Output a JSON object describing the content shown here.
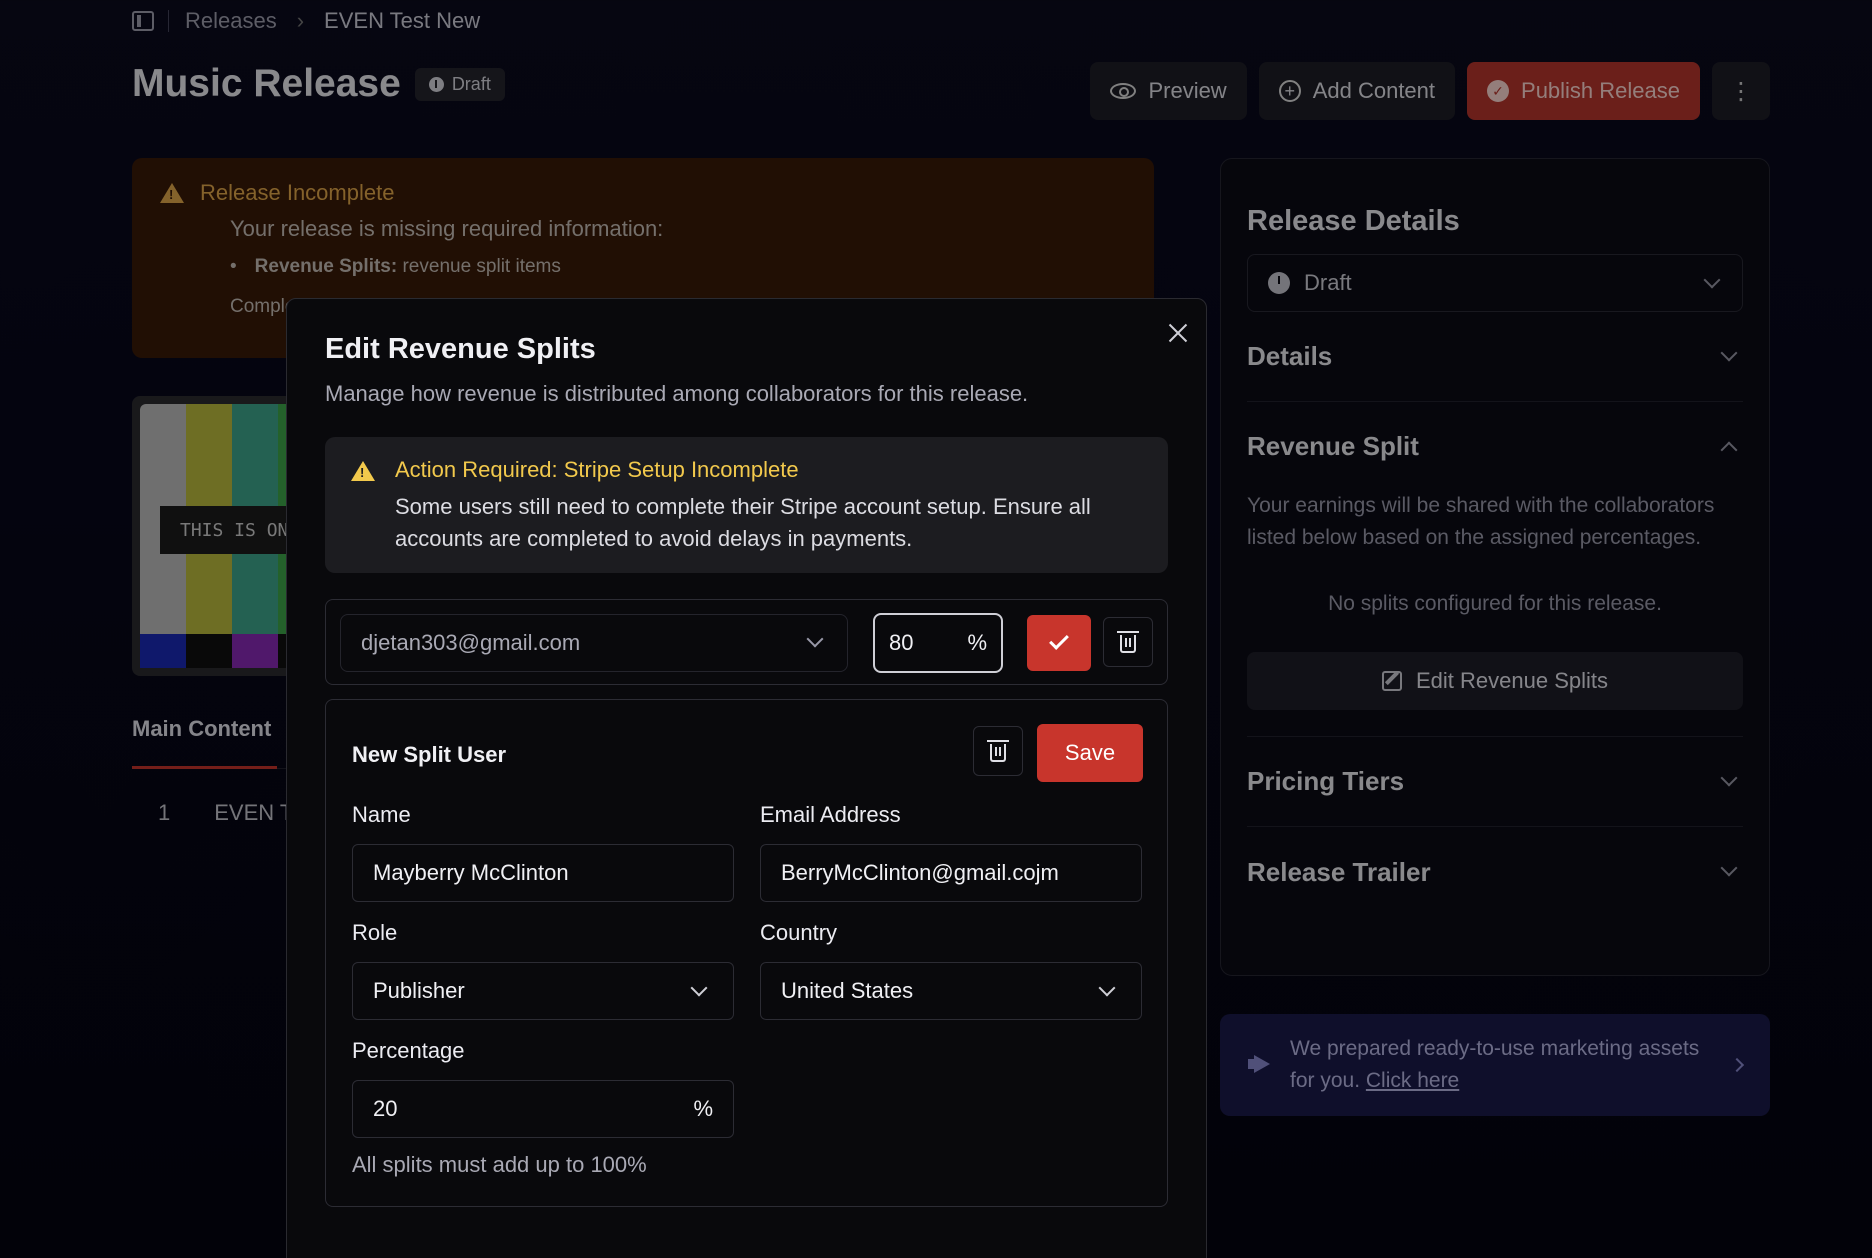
{
  "breadcrumb": {
    "section": "Releases",
    "current": "EVEN Test New"
  },
  "header": {
    "title": "Music Release",
    "status_badge": "Draft"
  },
  "actions": {
    "preview": "Preview",
    "add_content": "Add Content",
    "publish": "Publish Release",
    "more": "⋮"
  },
  "alert": {
    "title": "Release Incomplete",
    "subtitle": "Your release is missing required information:",
    "item_key": "Revenue Splits:",
    "item_value": " revenue split items",
    "footer": "Complete"
  },
  "cover": {
    "text": "THIS IS ONL"
  },
  "main": {
    "tab": "Main Content",
    "track_number": "1",
    "track_title": "EVEN Te"
  },
  "sidebar": {
    "title": "Release Details",
    "status_select": "Draft",
    "details": "Details",
    "revenue_split": {
      "title": "Revenue Split",
      "description": "Your earnings will be shared with the collaborators listed below based on the assigned percentages.",
      "empty": "No splits configured for this release.",
      "edit_button": "Edit Revenue Splits"
    },
    "pricing_tiers": "Pricing Tiers",
    "release_trailer": "Release Trailer"
  },
  "marketing": {
    "text": "We prepared ready-to-use marketing assets for you. ",
    "link": "Click here"
  },
  "modal": {
    "title": "Edit Revenue Splits",
    "subtitle": "Manage how revenue is distributed among collaborators for this release.",
    "warning": {
      "title": "Action Required: Stripe Setup Incomplete",
      "text": "Some users still need to complete their Stripe account setup. Ensure all accounts are completed to avoid delays in payments."
    },
    "split": {
      "email": "djetan303@gmail.com",
      "percentage": "80",
      "percent_sign": "%"
    },
    "new_split": {
      "title": "New Split User",
      "save": "Save",
      "name_label": "Name",
      "name_value": "Mayberry McClinton",
      "email_label": "Email Address",
      "email_value": "BerryMcClinton@gmail.cojm",
      "role_label": "Role",
      "role_value": "Publisher",
      "country_label": "Country",
      "country_value": "United States",
      "percentage_label": "Percentage",
      "percentage_value": "20",
      "percent_sign": "%",
      "hint": "All splits must add up to 100%"
    }
  },
  "colors": {
    "accent": "#c8352c",
    "warning": "#f2c94c",
    "alert_bg": "#3a1a08"
  }
}
